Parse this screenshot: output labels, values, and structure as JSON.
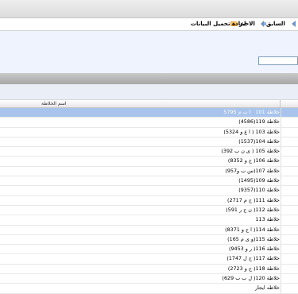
{
  "toolbar": {
    "previous_label": "السابق",
    "last_label": "الاخير",
    "reload_label": "اعادة تحميل البيانات"
  },
  "search": {
    "value": ""
  },
  "grid": {
    "column_header": "اسم الخلاطة",
    "rows": [
      "خلاطة 101   ا ب م 5795",
      "خلاطة 119(4586)",
      "خلاطة 103 ( ا ع و 5324)",
      "خلاطة 104(1537)",
      "خلاطة 105 ( ى ن ب 392)",
      "خلاطة 106( ج و 8352)",
      "خلاطة 107(س ب و957)",
      "خلاطة 109(1495)",
      "خلاطة 110(9357)",
      "خلاطة 111( ج م 2717)",
      "خلاطة 112( ن ج ر 591)",
      "خلاطة 113",
      "خلاطة 114( ا ج و 8371)",
      "خلاطة 115(و ى م 165)",
      "خلاطة 116( ر و 9453)",
      "خلاطة 117( ج ل 1747)",
      "خلاطة 118( ج و 2723)",
      "خلاطة 120( ل ب ب 629)",
      "خلاطه ايجار"
    ],
    "selected_index": 0
  },
  "colors": {
    "selection": "#a9c4ec",
    "panel": "#eef3fd",
    "band": "#b8b8b8"
  },
  "icons": [
    "back-arrow-icon",
    "last-arrow-icon",
    "reload-icon"
  ]
}
